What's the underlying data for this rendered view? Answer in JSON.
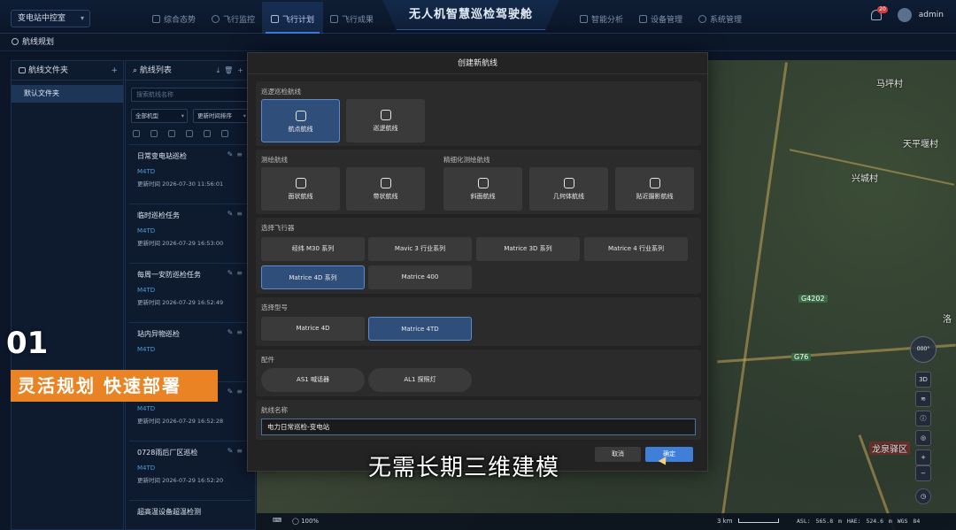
{
  "header": {
    "station_select": "变电站中控室",
    "nav_left": [
      "综合态势",
      "飞行监控",
      "飞行计划",
      "飞行成果"
    ],
    "active_nav": "飞行计划",
    "app_title": "无人机智慧巡检驾驶舱",
    "nav_right": [
      "智能分析",
      "设备管理",
      "系统管理"
    ],
    "notification_count": "20",
    "user": "admin"
  },
  "breadcrumb": "航线规划",
  "folder_panel": {
    "title": "航线文件夹",
    "items": [
      "默认文件夹"
    ]
  },
  "route_panel": {
    "title": "航线列表",
    "search_placeholder": "搜索航线名称",
    "filter_model": "全部机型",
    "filter_sort": "更新时间排序",
    "routes": [
      {
        "name": "日常变电站巡检",
        "model": "M4TD",
        "time": "更新时间  2026-07-30 11:56:01"
      },
      {
        "name": "临时巡检任务",
        "model": "M4TD",
        "time": "更新时间  2026-07-29 16:53:00"
      },
      {
        "name": "每周一安防巡检任务",
        "model": "M4TD",
        "time": "更新时间  2026-07-29 16:52:49"
      },
      {
        "name": "站内异物巡检",
        "model": "M4TD",
        "time": ""
      },
      {
        "name": "缺陷复检巡检",
        "model": "M4TD",
        "time": "更新时间  2026-07-29 16:52:28"
      },
      {
        "name": "0728雨后厂区巡检",
        "model": "M4TD",
        "time": "更新时间  2026-07-29 16:52:20"
      },
      {
        "name": "超高温设备超温检测",
        "model": "",
        "time": ""
      }
    ]
  },
  "modal": {
    "title": "创建新航线",
    "sec_inspection": "巡逻巡检航线",
    "inspection_tiles": [
      "航点航线",
      "巡逻航线"
    ],
    "sec_mapping": "测绘航线",
    "mapping_tiles": [
      "面状航线",
      "带状航线"
    ],
    "sec_fine": "精细化测绘航线",
    "fine_tiles": [
      "斜面航线",
      "几何体航线",
      "贴近摄影航线"
    ],
    "sec_aircraft": "选择飞行器",
    "aircraft": [
      "经纬 M30 系列",
      "Mavic 3 行业系列",
      "Matrice 3D 系列",
      "Matrice 4 行业系列",
      "Matrice 4D 系列",
      "Matrice 400"
    ],
    "sec_model": "选择型号",
    "models": [
      "Matrice 4D",
      "Matrice 4TD"
    ],
    "sec_accessory": "配件",
    "accessories": [
      "AS1 喊话器",
      "AL1 探照灯"
    ],
    "sec_name": "航线名称",
    "route_name_value": "电力日常巡检-变电站",
    "cancel": "取消",
    "confirm": "确定"
  },
  "map": {
    "labels": [
      "马坪村",
      "天平堰村",
      "兴城村",
      "洛",
      "龙泉驿区"
    ],
    "highways": [
      "G4202",
      "G76"
    ],
    "controls": [
      "3D"
    ],
    "compass_label": "000°",
    "zoom": "100%",
    "scale": "3 km",
    "coords": "ASL: 565.8 m  HAE: 524.6 m  WGS 84"
  },
  "overlay": {
    "step_number": "01",
    "slogan": "灵活规划 快速部署",
    "subtitle": "无需长期三维建模"
  },
  "colors": {
    "accent": "#3f7fd8",
    "slogan_bg": "#e98323",
    "selected_tile": "#2f4e7a"
  }
}
